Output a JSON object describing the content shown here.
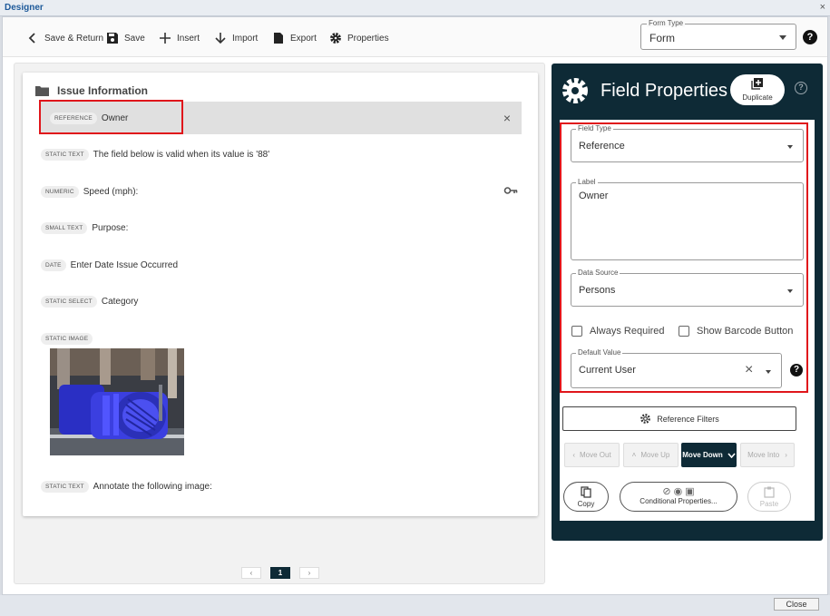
{
  "window": {
    "title": "Designer",
    "close_glyph": "×"
  },
  "toolbar": {
    "save_return": "Save & Return",
    "save": "Save",
    "insert": "Insert",
    "import": "Import",
    "export": "Export",
    "properties": "Properties",
    "form_type_legend": "Form Type",
    "form_type_value": "Form",
    "help_glyph": "?"
  },
  "section": {
    "title": "Issue Information",
    "fields": [
      {
        "tag": "REFERENCE",
        "label": "Owner"
      },
      {
        "tag": "STATIC TEXT",
        "label": "The field below is valid when its value is '88'"
      },
      {
        "tag": "NUMERIC",
        "label": "Speed (mph):"
      },
      {
        "tag": "SMALL TEXT",
        "label": "Purpose:"
      },
      {
        "tag": "DATE",
        "label": "Enter Date Issue Occurred"
      },
      {
        "tag": "STATIC SELECT",
        "label": "Category"
      },
      {
        "tag": "STATIC IMAGE",
        "label": ""
      },
      {
        "tag": "STATIC TEXT",
        "label": "Annotate the following image:"
      }
    ],
    "remove_glyph": "×"
  },
  "pager": {
    "prev": "‹",
    "current": "1",
    "next": "›"
  },
  "properties": {
    "title": "Field Properties",
    "duplicate": "Duplicate",
    "help_glyph": "?",
    "field_type_legend": "Field Type",
    "field_type_value": "Reference",
    "label_legend": "Label",
    "label_value": "Owner",
    "data_source_legend": "Data Source",
    "data_source_value": "Persons",
    "always_required": "Always Required",
    "show_barcode": "Show Barcode Button",
    "default_value_legend": "Default Value",
    "default_value": "Current User",
    "clear_glyph": "×",
    "reference_filters": "Reference Filters",
    "move_out": "Move Out",
    "move_up": "Move Up",
    "move_down": "Move Down",
    "move_into": "Move Into",
    "copy": "Copy",
    "conditional": "Conditional Properties...",
    "paste": "Paste"
  },
  "footer": {
    "close": "Close"
  }
}
